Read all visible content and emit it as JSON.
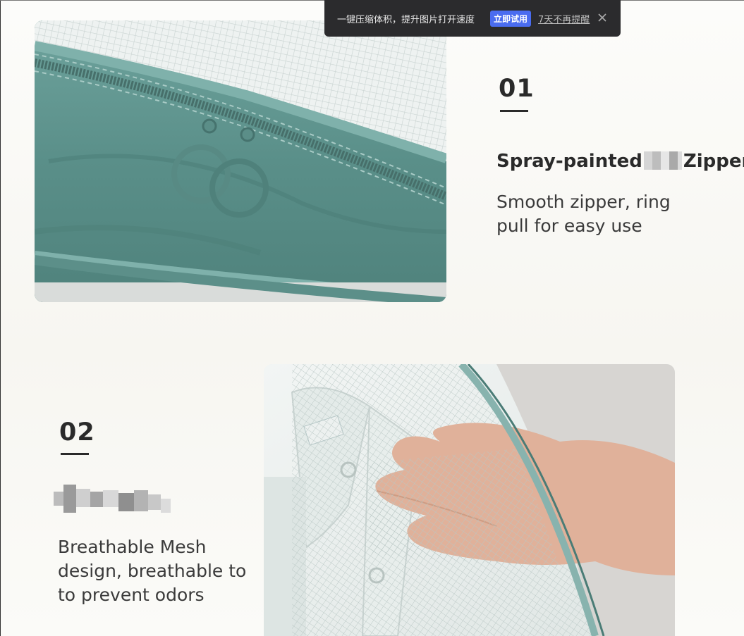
{
  "toast": {
    "message": "一键压缩体积，提升图片打开速度",
    "try_now": "立即试用",
    "dismiss_7_days": "7天不再提醒"
  },
  "feature_1": {
    "number": "01",
    "title_before": "Spray-painted",
    "title_after": "Zipper",
    "description": "Smooth zipper, ring pull for easy use"
  },
  "feature_2": {
    "number": "02",
    "description": "Breathable Mesh design, breathable to to prevent odors"
  },
  "colors": {
    "fabric": "#5f948e",
    "fabric_dark": "#3f716b",
    "mesh": "#e9eeec",
    "text": "#2a2a2a",
    "toast_bg": "#2b2b2d",
    "toast_cta": "#4a6cf0"
  },
  "icons": {
    "toast_close": "close-icon"
  }
}
